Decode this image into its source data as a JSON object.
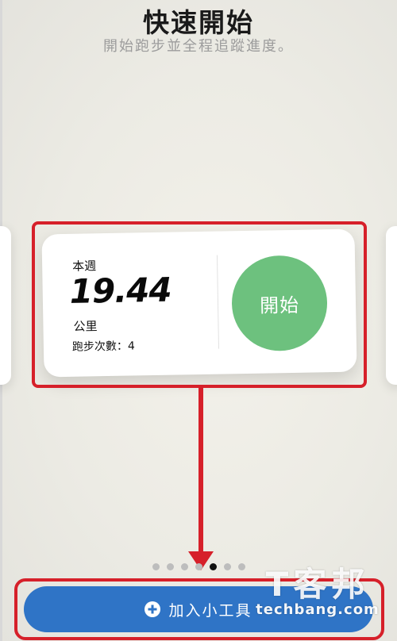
{
  "header": {
    "title": "快速開始",
    "subtitle": "開始跑步並全程追蹤進度。"
  },
  "widget": {
    "week_label": "本週",
    "distance": "19.44",
    "unit": "公里",
    "run_count": "跑步次數：4",
    "start_label": "開始"
  },
  "pagination": {
    "total": 7,
    "active_index": 4
  },
  "footer": {
    "add_widget_label": "加入小工具"
  },
  "watermark": {
    "logo_text": "T客邦",
    "url": "techbang.com"
  },
  "colors": {
    "accent_blue": "#2f74c6",
    "start_green": "#6dc17e",
    "annotation_red": "#d6202a"
  },
  "icons": {
    "add": "plus-circle-icon"
  }
}
